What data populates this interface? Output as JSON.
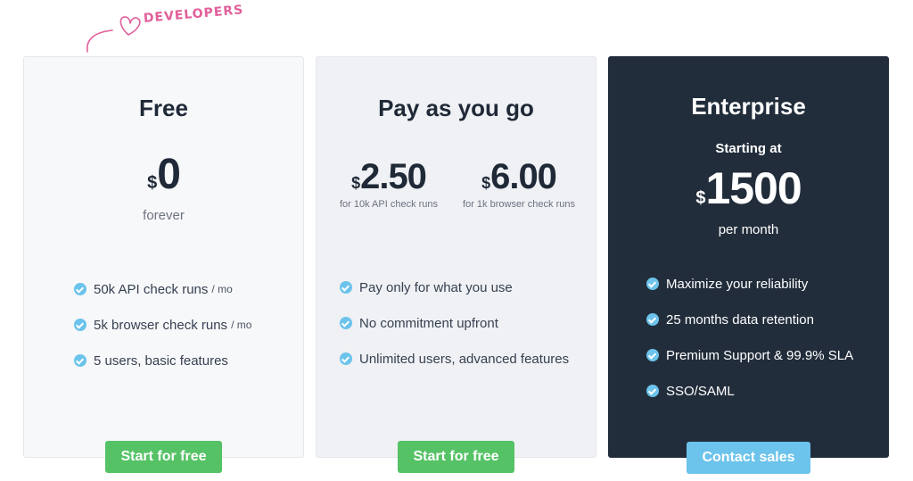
{
  "badge": {
    "label": "DEVELOPERS",
    "icon": "heart-icon",
    "color": "#e25f9a"
  },
  "plans": {
    "free": {
      "title": "Free",
      "currency": "$",
      "price": "0",
      "period": "forever",
      "features": [
        {
          "text": "50k API check runs",
          "unit": "/ mo"
        },
        {
          "text": "5k browser check runs",
          "unit": "/ mo"
        },
        {
          "text": "5 users, basic features",
          "unit": ""
        }
      ],
      "cta": "Start for free"
    },
    "payg": {
      "title": "Pay as you go",
      "prices": [
        {
          "currency": "$",
          "amount": "2.50",
          "note": "for 10k API check runs"
        },
        {
          "currency": "$",
          "amount": "6.00",
          "note": "for 1k browser check runs"
        }
      ],
      "features": [
        {
          "text": "Pay only for what you use"
        },
        {
          "text": "No commitment upfront"
        },
        {
          "text": "Unlimited users, advanced features"
        }
      ],
      "cta": "Start for free"
    },
    "enterprise": {
      "title": "Enterprise",
      "starting": "Starting at",
      "currency": "$",
      "price": "1500",
      "period": "per month",
      "features": [
        {
          "text": "Maximize your reliability"
        },
        {
          "text": "25 months data retention"
        },
        {
          "text": "Premium Support & 99.9% SLA"
        },
        {
          "text": "SSO/SAML"
        }
      ],
      "cta": "Contact sales"
    }
  },
  "colors": {
    "green": "#56c266",
    "blue": "#6cc3eb",
    "dark": "#222d3b",
    "check": "#6cc3eb"
  }
}
